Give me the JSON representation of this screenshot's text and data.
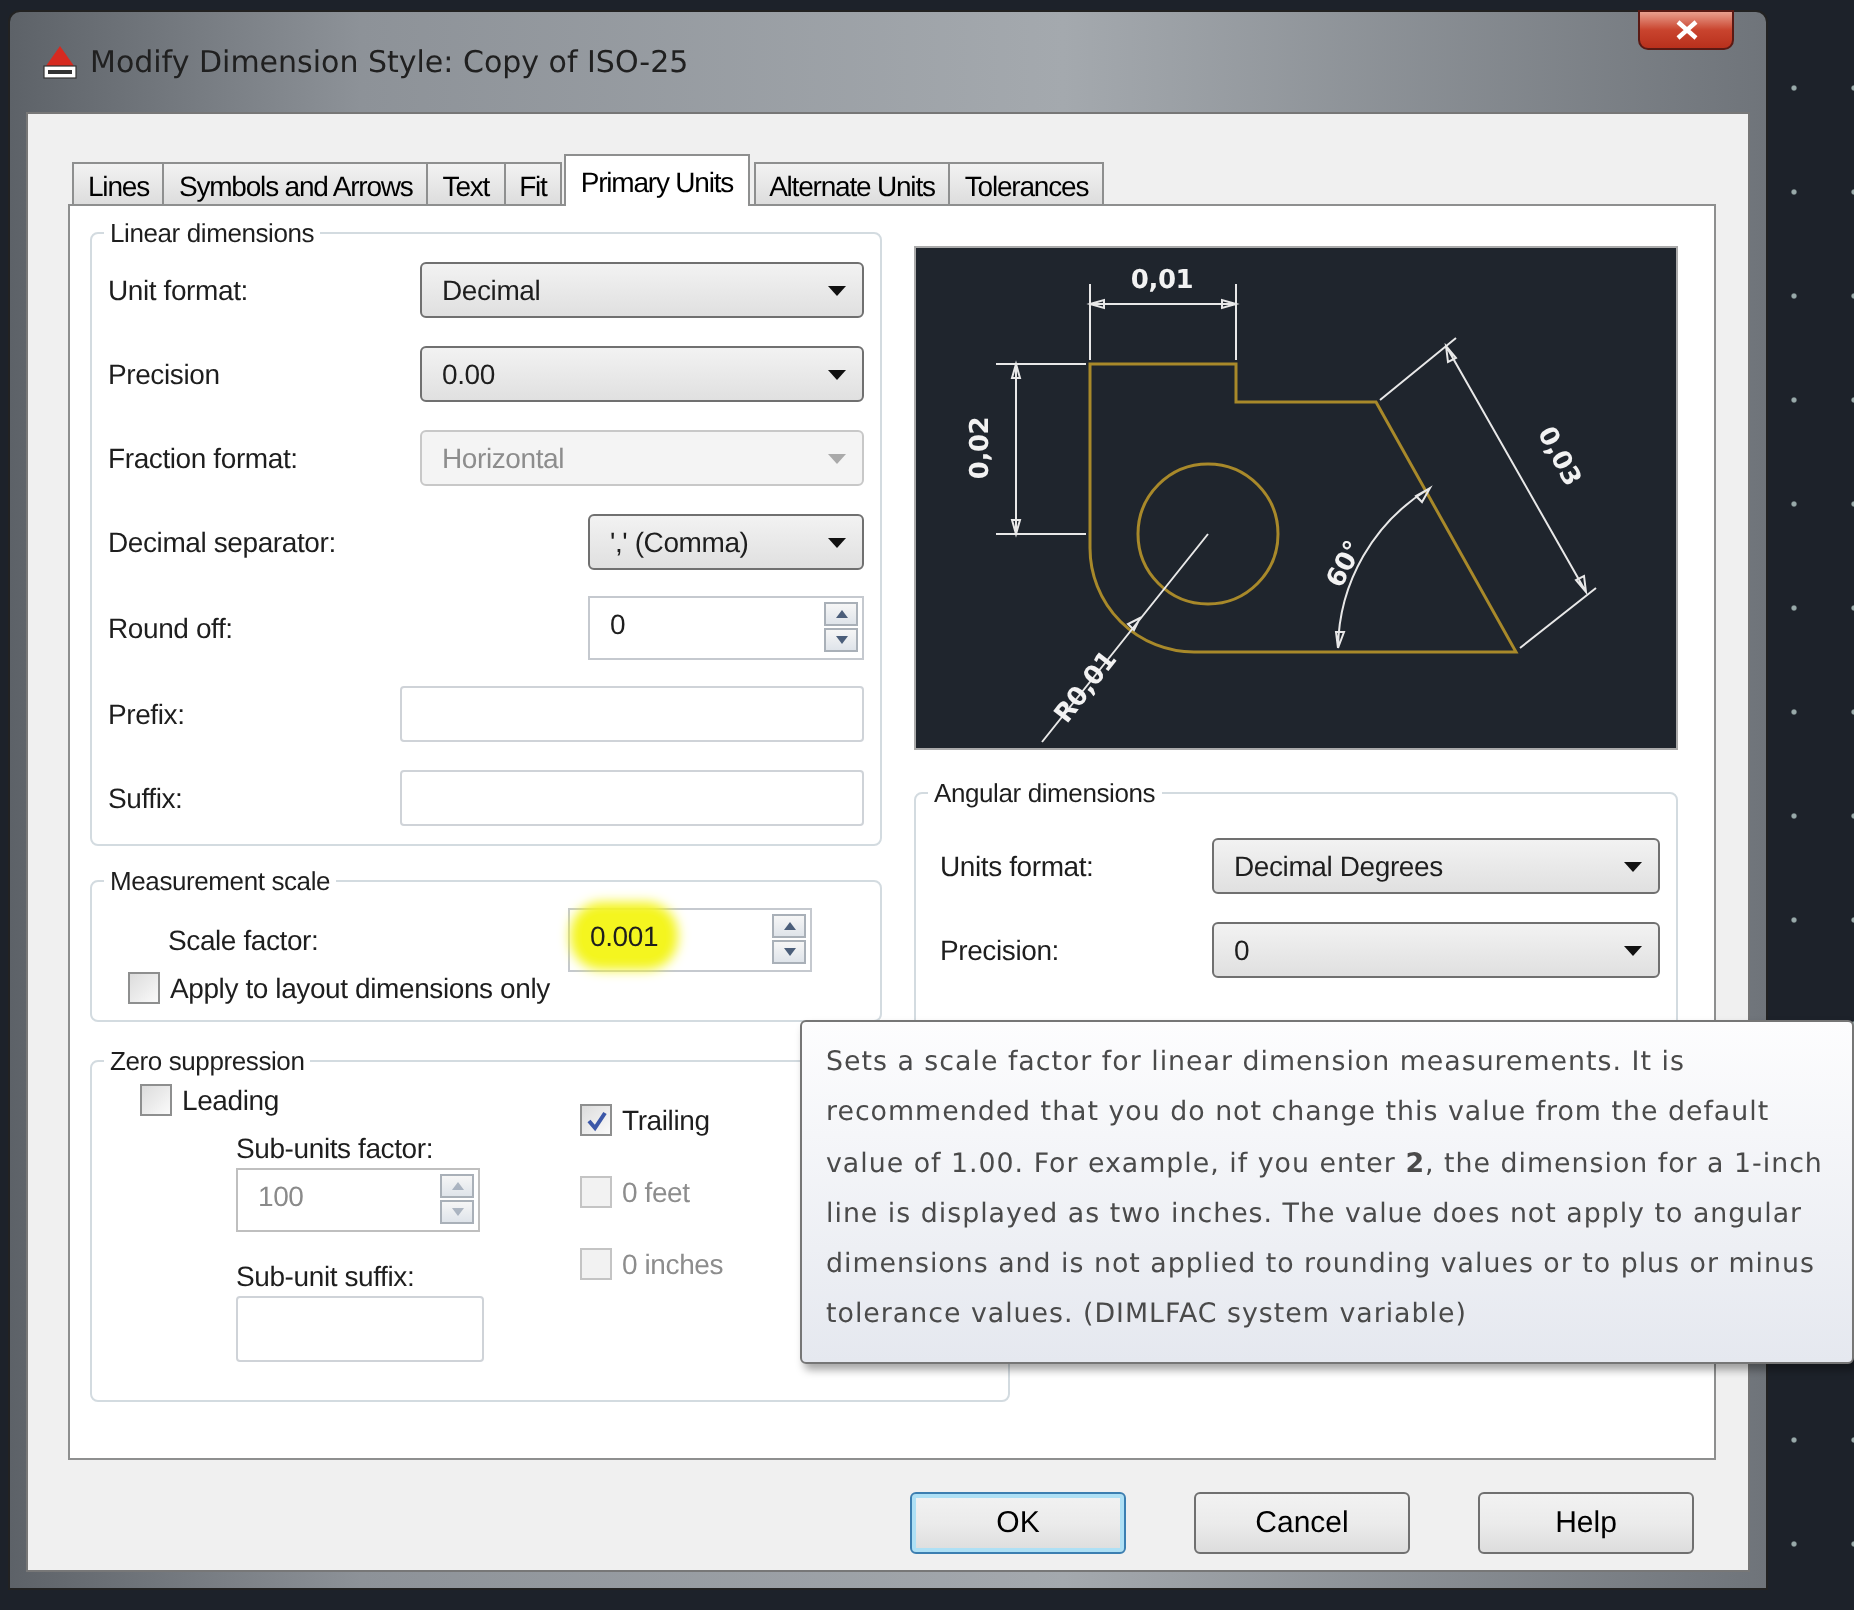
{
  "window": {
    "title": "Modify Dimension Style: Copy of ISO-25"
  },
  "tabs": [
    {
      "label": "Lines",
      "selected": false
    },
    {
      "label": "Symbols and Arrows",
      "selected": false
    },
    {
      "label": "Text",
      "selected": false
    },
    {
      "label": "Fit",
      "selected": false
    },
    {
      "label": "Primary Units",
      "selected": true
    },
    {
      "label": "Alternate Units",
      "selected": false
    },
    {
      "label": "Tolerances",
      "selected": false
    }
  ],
  "linear_dimensions": {
    "title": "Linear dimensions",
    "fields": [
      {
        "kind": "dropdown",
        "label": "Unit format:",
        "value": "Decimal",
        "disabled": false
      },
      {
        "kind": "dropdown",
        "label": "Precision",
        "value": "0.00",
        "disabled": false
      },
      {
        "kind": "dropdown",
        "label": "Fraction format:",
        "value": "Horizontal",
        "disabled": true
      },
      {
        "kind": "dropdown",
        "label": "Decimal separator:",
        "value": "',' (Comma)",
        "disabled": false
      },
      {
        "kind": "spinner",
        "label": "Round off:",
        "value": "0",
        "disabled": false
      },
      {
        "kind": "text",
        "label": "Prefix:"
      },
      {
        "kind": "text",
        "label": "Suffix:"
      }
    ]
  },
  "measurement_scale": {
    "title": "Measurement scale",
    "scale_factor": {
      "label": "Scale factor:",
      "value": "0.001",
      "highlighted": true
    },
    "apply_to_layout": {
      "label": "Apply to layout dimensions only",
      "checked": false
    }
  },
  "zero_suppression": {
    "title": "Zero suppression",
    "leading": {
      "label": "Leading",
      "checked": false
    },
    "sub_units_factor": {
      "label": "Sub-units factor:",
      "value": "100",
      "disabled": true
    },
    "sub_unit_suffix": {
      "label": "Sub-unit suffix:"
    },
    "trailing": [
      {
        "label": "Trailing",
        "checked": true,
        "disabled": false
      },
      {
        "label": "0 feet",
        "checked": false,
        "disabled": true
      },
      {
        "label": "0 inches",
        "checked": false,
        "disabled": true
      }
    ]
  },
  "preview": {
    "labels": [
      "0,01",
      "0,02",
      "0,03",
      "60°",
      "R0,01"
    ]
  },
  "angular_dimensions": {
    "title": "Angular dimensions",
    "fields": [
      {
        "kind": "dropdown",
        "label": "Units format:",
        "value": "Decimal Degrees",
        "disabled": false
      },
      {
        "kind": "dropdown",
        "label": "Precision:",
        "value": "0",
        "disabled": false
      }
    ]
  },
  "tooltip": {
    "text": "Sets a scale factor for linear dimension measurements. It is recommended that you do not change this value from the default value of 1.00. For example, if you enter **2**, the dimension for a 1-inch line is displayed as two inches. The value does not apply to angular dimensions and is not applied to rounding values or to plus or minus tolerance values. (DIMLFAC system variable)"
  },
  "buttons": [
    {
      "label": "OK",
      "default": true
    },
    {
      "label": "Cancel",
      "default": false
    },
    {
      "label": "Help",
      "default": false
    }
  ]
}
